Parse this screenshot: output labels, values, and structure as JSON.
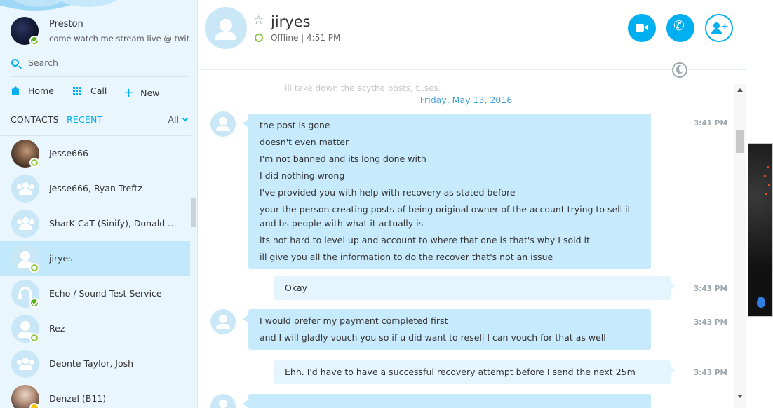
{
  "profile": {
    "name": "Preston",
    "mood": "come watch me stream live @ twitch..."
  },
  "search": {
    "placeholder": "Search"
  },
  "nav": {
    "home": "Home",
    "call": "Call",
    "new": "New"
  },
  "tabs": {
    "contacts": "CONTACTS",
    "recent": "RECENT",
    "filter": "All"
  },
  "contacts": [
    {
      "name": "Jesse666",
      "avatar": "photo",
      "status": "offline"
    },
    {
      "name": "Jesse666, Ryan Treftz",
      "avatar": "group",
      "status": "none"
    },
    {
      "name": "SharK CaT (Sinify), Donald Mc...",
      "avatar": "group",
      "status": "none"
    },
    {
      "name": "jiryes",
      "avatar": "person",
      "status": "offline",
      "selected": true
    },
    {
      "name": "Echo / Sound Test Service",
      "avatar": "headset",
      "status": "online"
    },
    {
      "name": "Rez",
      "avatar": "person",
      "status": "offline"
    },
    {
      "name": "Deonte Taylor, Josh",
      "avatar": "group",
      "status": "none"
    },
    {
      "name": "Denzel (B11)",
      "avatar": "photo",
      "status": "away"
    }
  ],
  "header": {
    "contact_name": "jiryes",
    "status": "Offline | 4:51 PM"
  },
  "conversation": {
    "faded_message": "ill take down the scythe posts, t..ses.",
    "date": "Friday, May 13, 2016",
    "messages": [
      {
        "direction": "in",
        "time": "3:41 PM",
        "lines": [
          "the post is gone",
          "doesn't even matter",
          "I'm not banned and its long done with",
          "I did nothing wrong",
          "I've provided you with help with recovery as stated before",
          "your the person creating posts of being original owner of the account trying to sell it and bs people with what it actually is",
          "its not hard to level up and account to where that one is that's why I sold it",
          "ill give you all the information to do the recover that's not an issue"
        ]
      },
      {
        "direction": "out",
        "time": "3:43 PM",
        "lines": [
          "Okay"
        ]
      },
      {
        "direction": "in",
        "time": "3:43 PM",
        "lines": [
          "I would prefer my payment completed first",
          "and I will gladly vouch you so if u did want to resell I can vouch for that as well"
        ]
      },
      {
        "direction": "out",
        "time": "3:43 PM",
        "lines": [
          "Ehh. I'd have to have a successful recovery attempt before I send the next 25m"
        ]
      }
    ]
  },
  "colors": {
    "accent": "#00aff0",
    "sidebar_bg": "#eaf6fd",
    "incoming_bubble": "#c7eafc",
    "outgoing_bubble": "#e5f5fe",
    "online": "#5ab11a",
    "offline_ring": "#8cc63f"
  }
}
